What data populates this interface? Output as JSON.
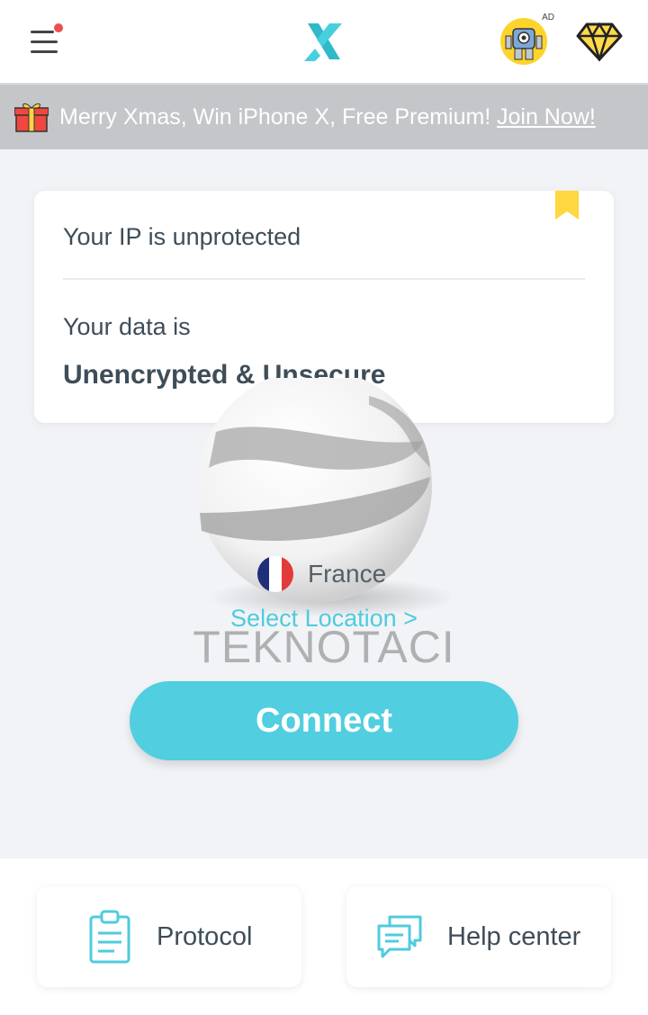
{
  "header": {
    "menu_icon": "hamburger-menu-icon",
    "notification_dot_color": "#f04e4e",
    "logo_icon": "x-logo-icon",
    "ad_label": "AD",
    "ad_icon": "robot-ad-icon",
    "premium_icon": "diamond-icon"
  },
  "promo": {
    "icon": "gift-icon",
    "text": "Merry Xmas, Win iPhone X, Free Premium!",
    "link": "Join Now!"
  },
  "status_card": {
    "ip_status": "Your IP is unprotected",
    "data_label": "Your data is",
    "data_status": "Unencrypted & Unsecure",
    "bookmark_icon": "bookmark-icon"
  },
  "location": {
    "country": "France",
    "flag_icon": "france-flag-icon",
    "select_label": "Select Location >"
  },
  "watermark": "TEKNOTACI",
  "connect_label": "Connect",
  "bottom": {
    "protocol_label": "Protocol",
    "help_label": "Help center"
  },
  "colors": {
    "accent": "#51cee0",
    "promo_bg": "#c4c6c9",
    "text": "#3e4d57",
    "bookmark": "#ffd740"
  }
}
